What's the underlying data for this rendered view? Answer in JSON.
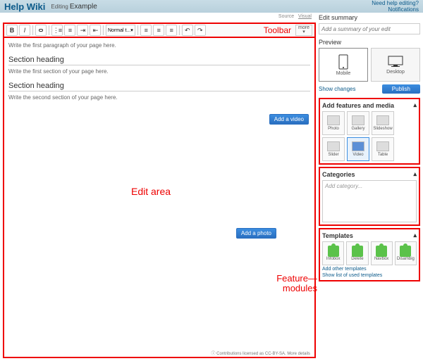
{
  "header": {
    "wiki_title": "Help Wiki",
    "editing_label": "Editing",
    "page_name": "Example",
    "help_link": "Need help editing?",
    "notifications": "Notifications"
  },
  "tabs": {
    "source": "Source",
    "visual": "Visual"
  },
  "toolbar": {
    "normal_text": "Normal t...",
    "more": "more",
    "label": "Toolbar"
  },
  "editor": {
    "first_para": "Write the first paragraph of your page here.",
    "sect1": "Section heading",
    "sect1_text": "Write the first section of your page here.",
    "sect2": "Section heading",
    "sect2_text": "Write the second section of your page here.",
    "add_video": "Add a video",
    "add_photo": "Add a photo",
    "edit_area_label": "Edit area",
    "feature_label_1": "Feature",
    "feature_label_2": "modules"
  },
  "sidebar": {
    "edit_summary_title": "Edit summary",
    "edit_summary_ph": "Add a summary of your edit",
    "preview_title": "Preview",
    "mobile": "Mobile",
    "desktop": "Desktop",
    "show_changes": "Show changes",
    "publish": "Publish",
    "features_title": "Add features and media",
    "feat": {
      "photo": "Photo",
      "gallery": "Gallery",
      "slideshow": "Slideshow",
      "slider": "Slider",
      "video": "Video",
      "table": "Table"
    },
    "categories_title": "Categories",
    "cat_ph": "Add category...",
    "templates_title": "Templates",
    "tmpl": {
      "infobox": "Infobox",
      "delete": "Delete",
      "navbox": "Navbox",
      "disambig": "Disambig"
    },
    "add_other": "Add other templates",
    "show_list": "Show list of used templates"
  },
  "footer": "Contributions licensed as CC-BY-SA. More details"
}
